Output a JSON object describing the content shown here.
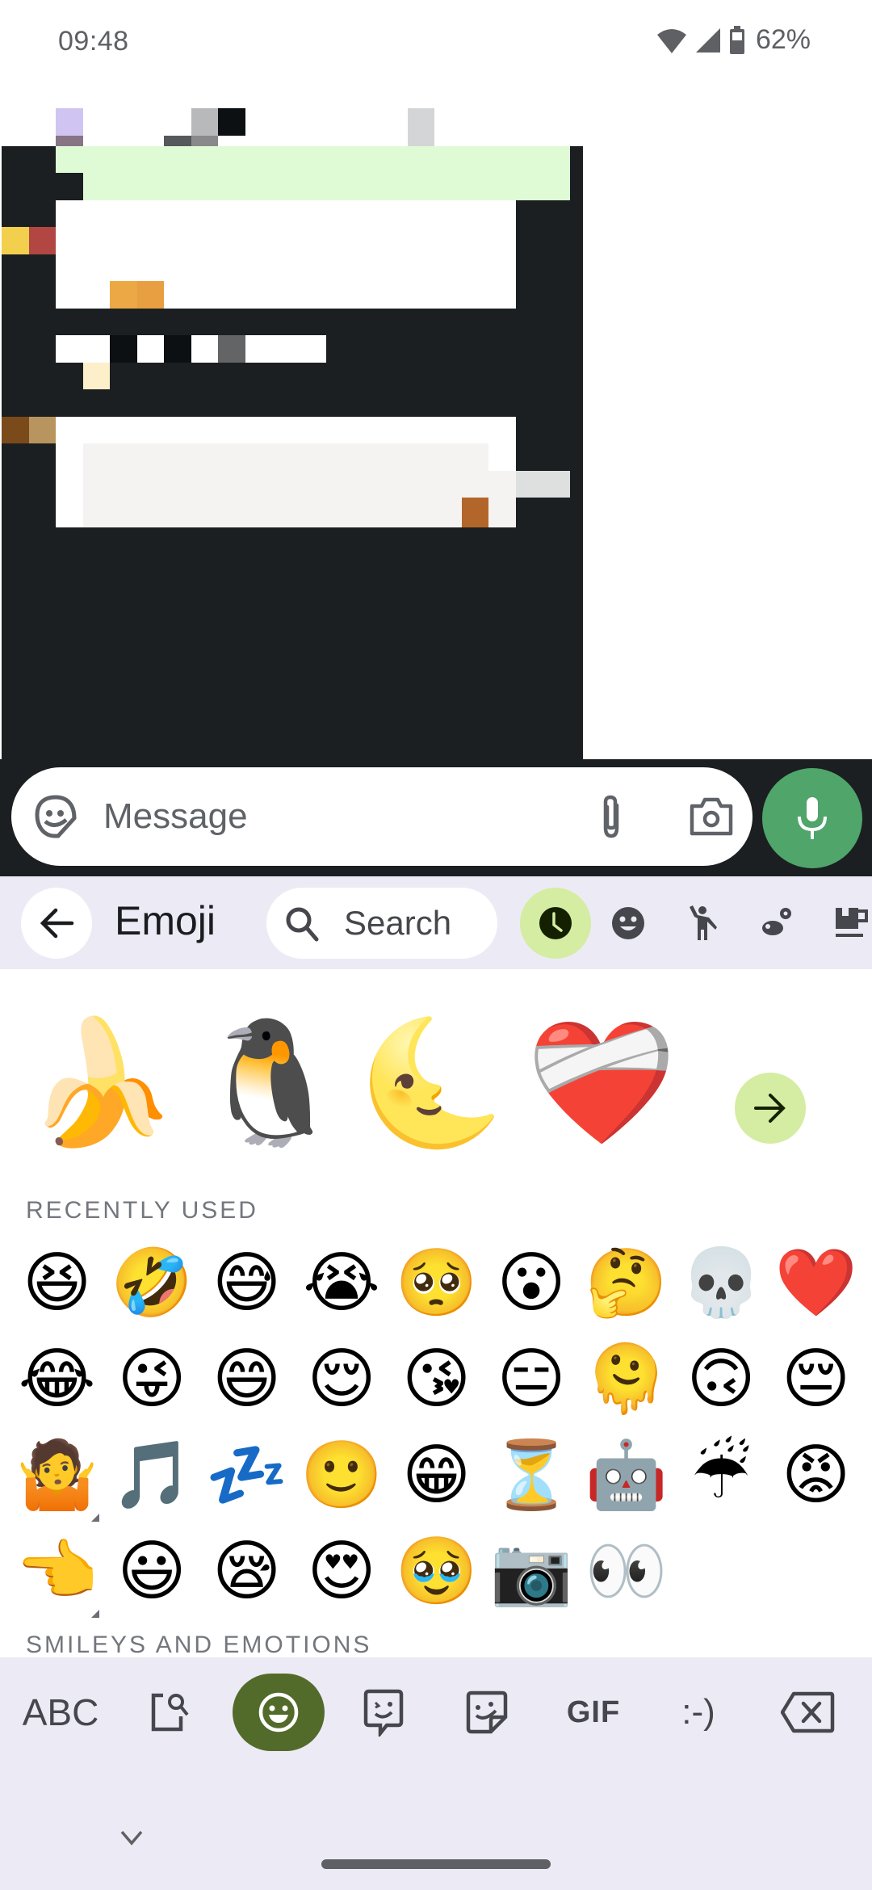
{
  "status_bar": {
    "time": "09:48",
    "battery": "62%",
    "icons": [
      "wifi-icon",
      "cell-signal-icon",
      "battery-icon"
    ]
  },
  "chat": {
    "obscured": true,
    "note_colors": {
      "background": "#1b1f21",
      "outgoing_bubble": "#dffbd6",
      "incoming_bubble": "#ffffff"
    }
  },
  "compose": {
    "placeholder": "Message",
    "sticker_icon": "sticker-smiley-icon",
    "attach_icon": "paperclip-icon",
    "camera_icon": "camera-icon",
    "mic_icon": "microphone-icon",
    "mic_color": "#4fa56a"
  },
  "emoji_header": {
    "back_icon": "arrow-left-icon",
    "title": "Emoji",
    "search_label": "Search",
    "categories": [
      {
        "name": "recent",
        "icon": "clock-icon",
        "active": true
      },
      {
        "name": "smileys",
        "icon": "smiley-icon",
        "active": false
      },
      {
        "name": "people",
        "icon": "person-waving-icon",
        "active": false
      },
      {
        "name": "nature",
        "icon": "bee-flower-icon",
        "active": false
      },
      {
        "name": "food",
        "icon": "cup-icon",
        "active": false
      }
    ],
    "accent": "#d4eda2"
  },
  "emoji_kitchen": {
    "items": [
      {
        "name": "banana-laughing-tears",
        "glyph": "🍌"
      },
      {
        "name": "penguin-bouquet",
        "glyph": "🐧"
      },
      {
        "name": "moon-hearts",
        "glyph": "🌜"
      },
      {
        "name": "mending-heart-hug",
        "glyph": "❤️‍🩹"
      }
    ],
    "next_icon": "arrow-right-icon"
  },
  "sections": {
    "recent_label": "RECENTLY USED",
    "smileys_label": "SMILEYS AND EMOTIONS"
  },
  "recent_emoji": [
    [
      "😆",
      "🤣",
      "😅",
      "😭",
      "🥺",
      "😮",
      "🤔",
      "💀",
      "❤️"
    ],
    [
      "😂",
      "😜",
      "😄",
      "😌",
      "😘",
      "😑",
      "🫠",
      "🙃",
      "😔"
    ],
    [
      "🤷",
      "🎵",
      "💤",
      "🙂",
      "😁",
      "⏳",
      "🤖",
      "☔",
      "😡"
    ],
    [
      "👈",
      "😃",
      "😪",
      "😍",
      "🥹",
      "📷",
      "👀"
    ]
  ],
  "variant_marked": [
    [
      2,
      0
    ],
    [
      3,
      0
    ]
  ],
  "keyboard_bar": {
    "abc_label": "ABC",
    "gif_label": "GIF",
    "emoticon_label": ":-)",
    "buttons": [
      "abc",
      "emoji-search-icon",
      "emoji-icon",
      "emoticon-bubble-icon",
      "sticker-icon",
      "gif",
      "emoticon",
      "backspace-icon"
    ],
    "active_color": "#536b2a"
  }
}
